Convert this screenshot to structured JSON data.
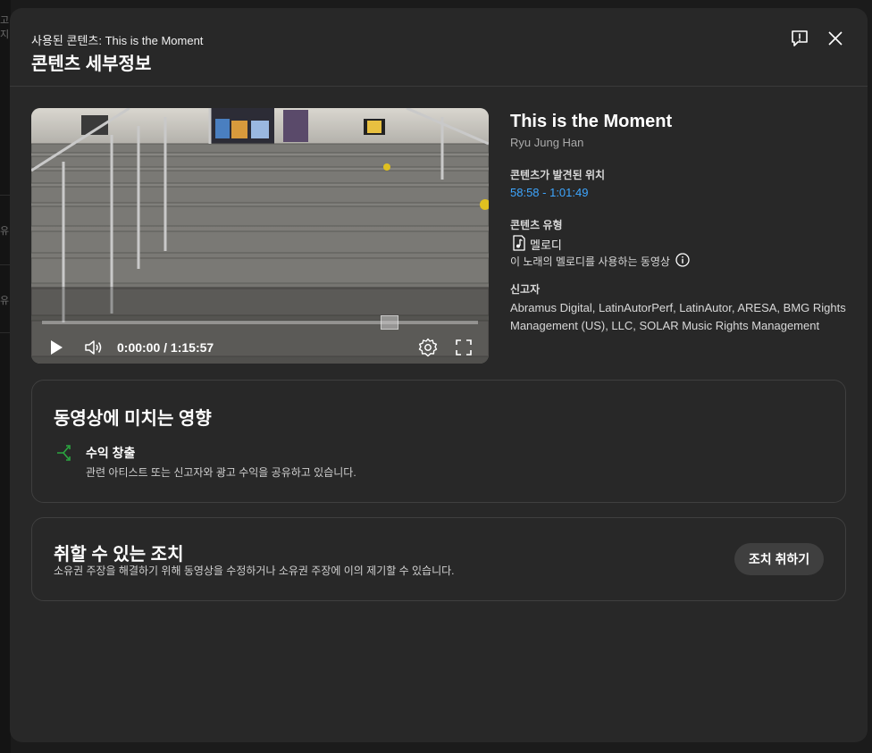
{
  "backdrop": {
    "fragments": [
      "고지",
      "유",
      "유"
    ]
  },
  "header": {
    "subtitle": "사용된 콘텐츠: This is the Moment",
    "title": "콘텐츠 세부정보",
    "report_icon": "report-flag-icon",
    "close_icon": "close-icon"
  },
  "player": {
    "time": "0:00:00 / 1:15:57",
    "progress": 0.0,
    "icons": [
      "play-icon",
      "volume-icon",
      "settings-gear-icon",
      "fullscreen-icon"
    ]
  },
  "details": {
    "song_title": "This is the Moment",
    "artist": "Ryu Jung Han",
    "found_label": "콘텐츠가 발견된 위치",
    "found_range": "58:58 - 1:01:49",
    "type_label": "콘텐츠 유형",
    "type_value": "멜로디",
    "type_desc": "이 노래의 멜로디를 사용하는 동영상",
    "claimants_label": "신고자",
    "claimants": "Abramus Digital, LatinAutorPerf, LatinAutor, ARESA, BMG Rights Management (US), LLC, SOLAR Music Rights Management"
  },
  "impact": {
    "title": "동영상에 미치는 영향",
    "item_name": "수익 창출",
    "item_desc": "관련 아티스트 또는 신고자와 광고 수익을 공유하고 있습니다."
  },
  "actions": {
    "title": "취할 수 있는 조치",
    "desc": "소유권 주장을 해결하기 위해 동영상을 수정하거나 소유권 주장에 이의 제기할 수 있습니다.",
    "button": "조치 취하기"
  },
  "colors": {
    "dialog_bg": "#282828",
    "link": "#3ea6ff",
    "monetize_icon": "#2ba640"
  }
}
